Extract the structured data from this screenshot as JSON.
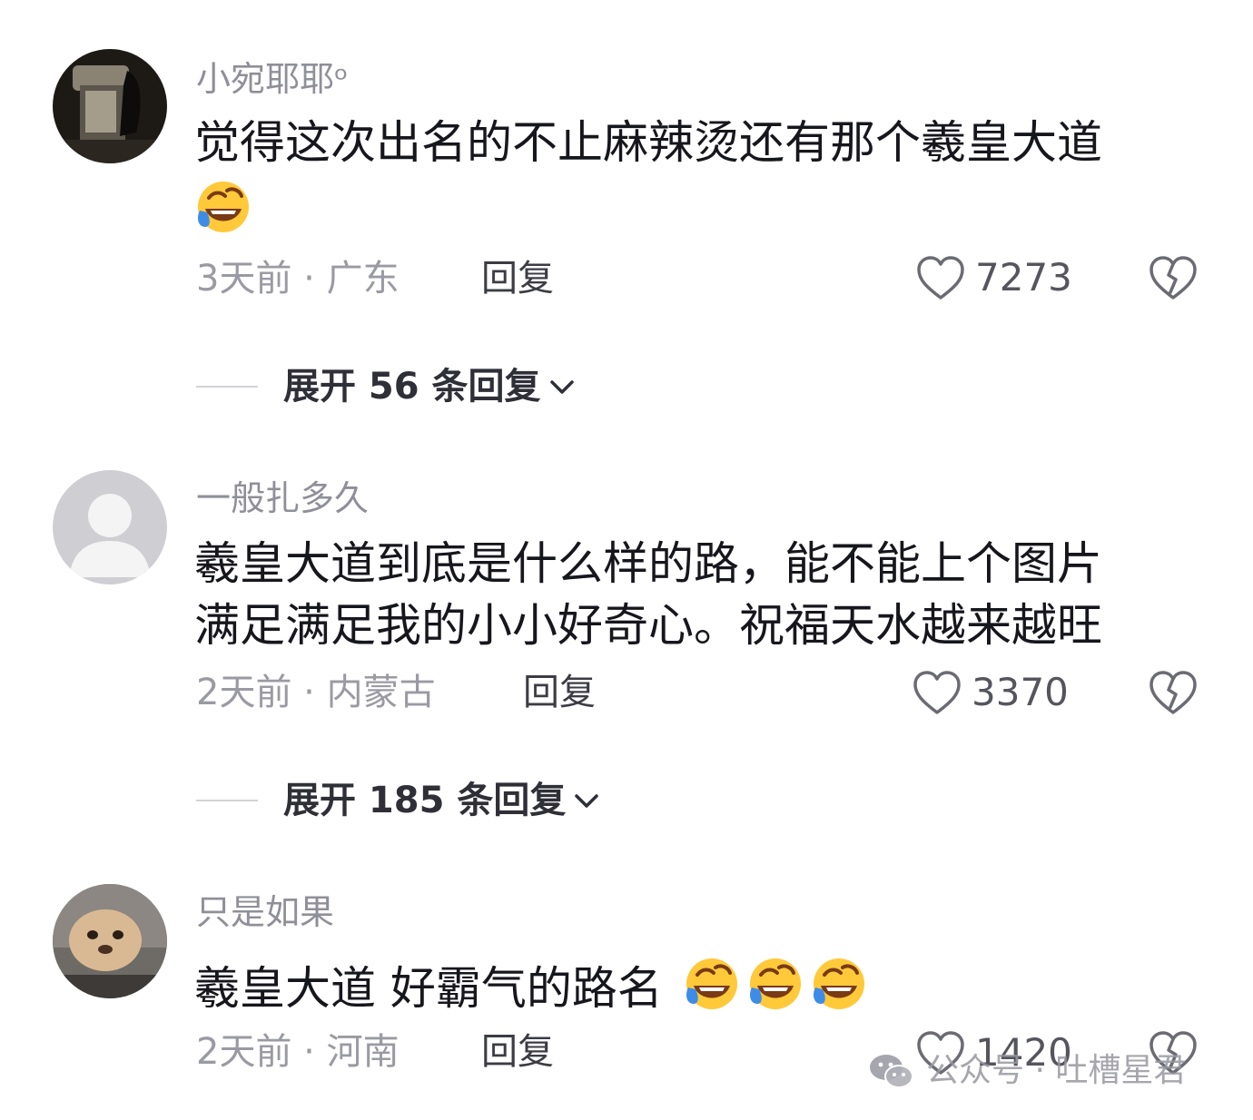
{
  "comments": [
    {
      "username": "小宛耶耶ᵒ",
      "lines": [
        "觉得这次出名的不止麻辣烫还有那个羲皇大道"
      ],
      "emoji_count": 1,
      "emoji_icon": "laughing-crying-emoji-icon",
      "time_location": "3天前 · 广东",
      "reply_label": "回复",
      "likes": "7273",
      "expand_label": "展开 56 条回复"
    },
    {
      "username": "一般扎多久",
      "lines": [
        "羲皇大道到底是什么样的路，能不能上个图片",
        "满足满足我的小小好奇心。祝福天水越来越旺"
      ],
      "emoji_count": 0,
      "time_location": "2天前 · 内蒙古",
      "reply_label": "回复",
      "likes": "3370",
      "expand_label": "展开 185 条回复"
    },
    {
      "username": "只是如果",
      "lines": [
        "羲皇大道 好霸气的路名"
      ],
      "emoji_count": 3,
      "emoji_icon": "laughing-crying-emoji-icon",
      "time_location": "2天前 · 河南",
      "reply_label": "回复",
      "likes": "1420"
    }
  ],
  "icons": {
    "like": "heart-outline-icon",
    "dislike": "broken-heart-icon",
    "expand": "chevron-down-icon"
  },
  "watermark": {
    "icon": "wechat-icon",
    "text": "公众号 · 吐槽星君"
  },
  "colors": {
    "username": "#8f8f99",
    "comment_text": "#16161d",
    "meta": "#9a9aa3",
    "emoji_face": "#ffc93a",
    "emoji_tear": "#3d8ce8"
  }
}
